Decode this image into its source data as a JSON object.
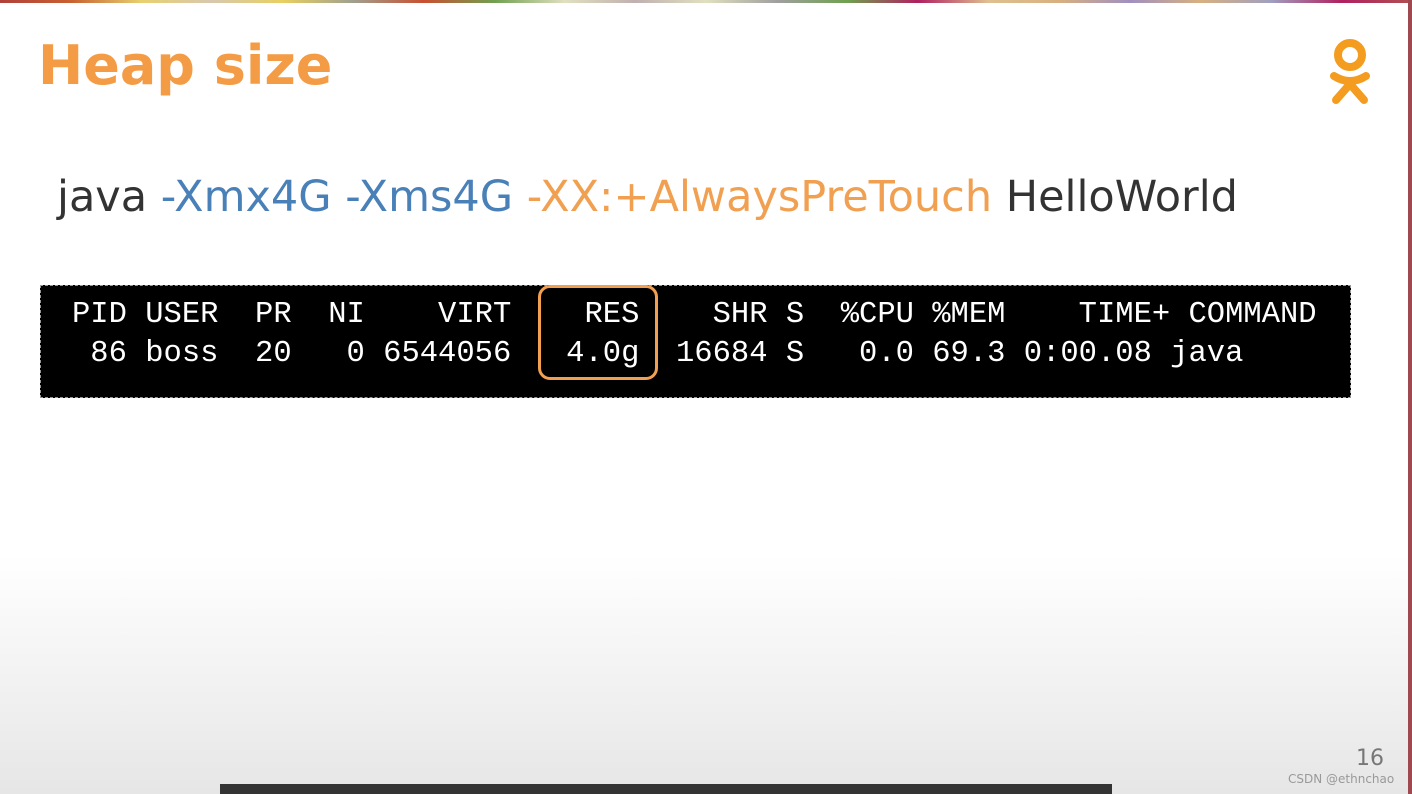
{
  "slide": {
    "title": "Heap size",
    "page_number": "16",
    "logo_icon": "odnoklassniki-logo",
    "colors": {
      "title": "#f39c45",
      "blue": "#4a80b8",
      "orange": "#f0a050",
      "highlight": "#f0a050"
    }
  },
  "command": {
    "prog": "java ",
    "xmx": "-Xmx4G ",
    "xms": "-Xms4G ",
    "pretouch": "-XX:+AlwaysPreTouch ",
    "main": "HelloWorld"
  },
  "terminal": {
    "header": "PID USER  PR  NI    VIRT    RES    SHR S  %CPU %MEM    TIME+ COMMAND",
    "row": " 86 boss  20   0 6544056   4.0g  16684 S   0.0 69.3 0:00.08 java",
    "highlighted_column": "RES"
  },
  "watermark": "CSDN @ethnchao"
}
